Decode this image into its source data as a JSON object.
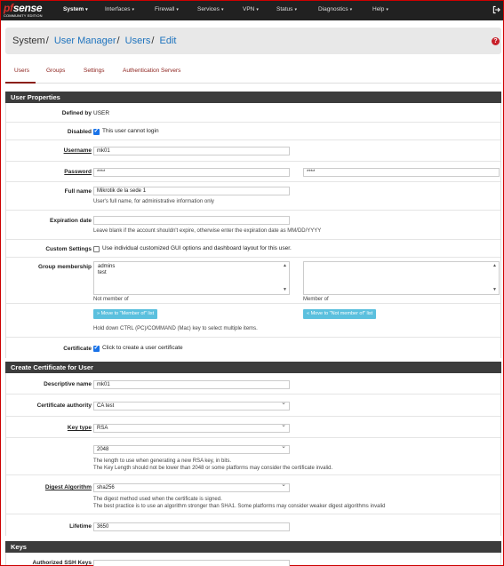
{
  "nav": {
    "brand_prefix": "pf",
    "brand_suffix": "sense",
    "edition": "COMMUNITY EDITION",
    "items": [
      "System",
      "Interfaces",
      "Firewall",
      "Services",
      "VPN",
      "Status",
      "Diagnostics",
      "Help"
    ]
  },
  "breadcrumb": {
    "root": "System",
    "items": [
      "User Manager",
      "Users",
      "Edit"
    ],
    "sep": "/"
  },
  "help_icon": "?",
  "tabs": [
    "Users",
    "Groups",
    "Settings",
    "Authentication Servers"
  ],
  "user_properties": {
    "title": "User Properties",
    "defined_by_label": "Defined by",
    "defined_by_value": "USER",
    "disabled_label": "Disabled",
    "disabled_text": "This user cannot login",
    "disabled_checked": true,
    "username_label": "Username",
    "username_value": "mk01",
    "password_label": "Password",
    "password_value": "****",
    "password_confirm_value": "****",
    "fullname_label": "Full name",
    "fullname_value": "Mikrotik de la sede 1",
    "fullname_help": "User's full name, for administrative information only",
    "expiration_label": "Expiration date",
    "expiration_value": "",
    "expiration_help": "Leave blank if the account shouldn't expire, otherwise enter the expiration date as MM/DD/YYYY",
    "custom_label": "Custom Settings",
    "custom_text": "Use individual customized GUI options and dashboard layout for this user.",
    "custom_checked": false,
    "group_label": "Group membership",
    "not_member_items": [
      "admins",
      "test"
    ],
    "not_member_caption": "Not member of",
    "member_caption": "Member of",
    "move_to_member": "Move to \"Member of\" list",
    "move_to_not_member": "Move to \"Not member of\" list",
    "multi_help": "Hold down CTRL (PC)/COMMAND (Mac) key to select multiple items.",
    "certificate_label": "Certificate",
    "certificate_text": "Click to create a user certificate",
    "certificate_checked": true
  },
  "create_cert": {
    "title": "Create Certificate for User",
    "descr_label": "Descriptive name",
    "descr_value": "mk01",
    "ca_label": "Certificate authority",
    "ca_value": "CA test",
    "keytype_label": "Key type",
    "keytype_value": "RSA",
    "keylen_value": "2048",
    "keylen_help1": "The length to use when generating a new RSA key, in bits.",
    "keylen_help2": "The Key Length should not be lower than 2048 or some platforms may consider the certificate invalid.",
    "digest_label": "Digest Algorithm",
    "digest_value": "sha256",
    "digest_help1": "The digest method used when the certificate is signed.",
    "digest_help2": "The best practice is to use an algorithm stronger than SHA1. Some platforms may consider weaker digest algorithms invalid",
    "lifetime_label": "Lifetime",
    "lifetime_value": "3650"
  },
  "keys": {
    "title": "Keys",
    "ssh_label": "Authorized SSH Keys"
  }
}
